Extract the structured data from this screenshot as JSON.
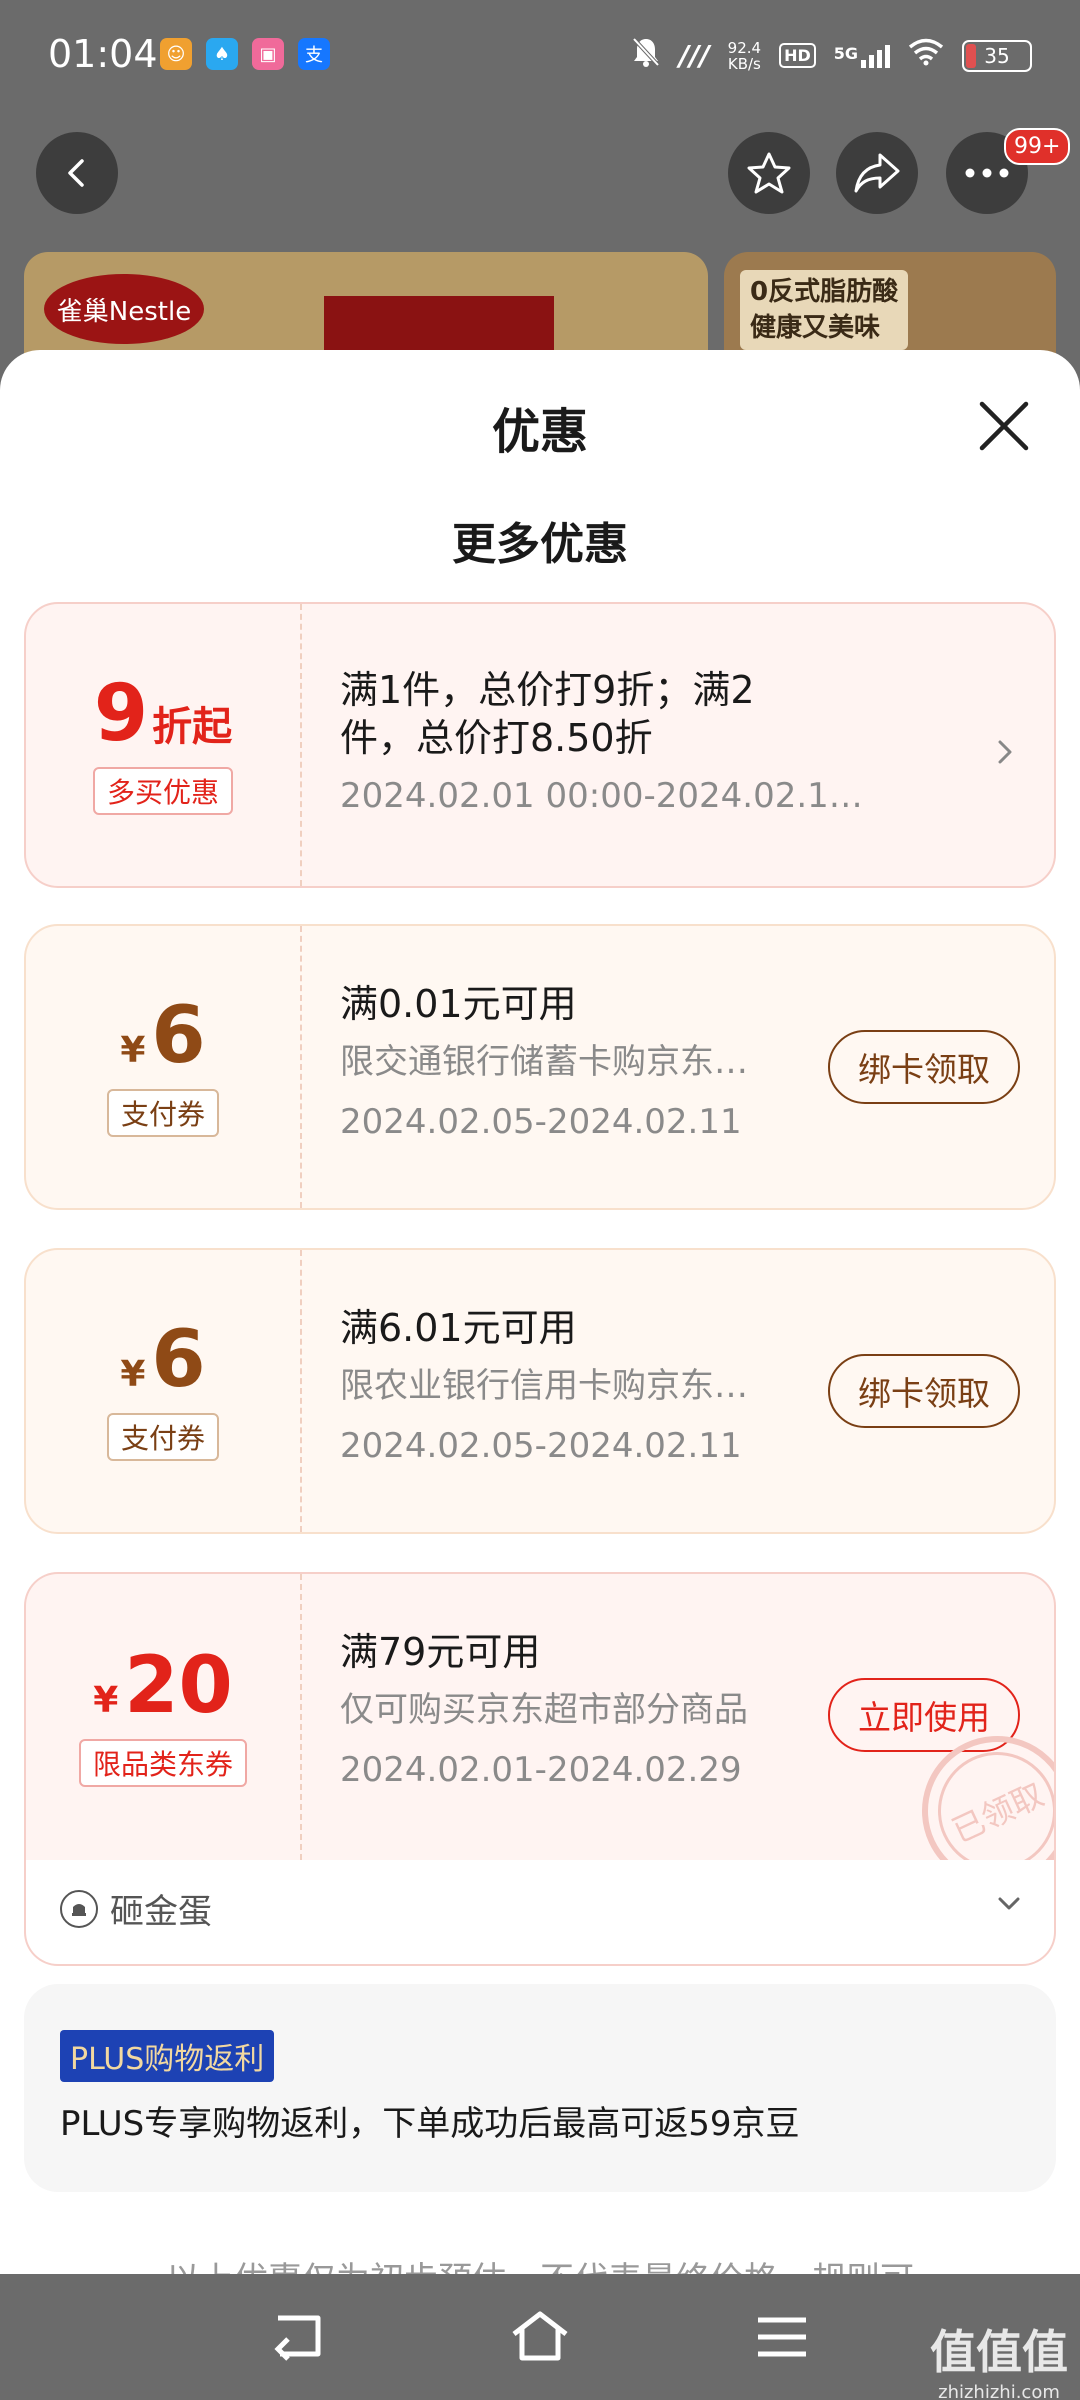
{
  "status_bar": {
    "time": "01:04",
    "net_speed_value": "92.4",
    "net_speed_unit": "KB/s",
    "hd": "HD",
    "signal": "5G",
    "battery": "35",
    "app_icons": [
      "doll-app-icon",
      "qq-icon",
      "bilibili-icon",
      "alipay-icon"
    ]
  },
  "top_nav": {
    "more_badge": "99+"
  },
  "background": {
    "product_logo": "雀巢Nestle",
    "promo_line1": "0反式脂肪酸",
    "promo_line2": "健康又美味"
  },
  "sheet": {
    "title": "优惠",
    "section_title": "更多优惠",
    "cards": [
      {
        "amount": "9",
        "unit": "折起",
        "tag": "多买优惠",
        "line1": "满1件，总价打9折；满2",
        "line2": "件，总价打8.50折",
        "line3": "2024.02.01 00:00-2024.02.1…"
      },
      {
        "currency": "¥",
        "amount": "6",
        "tag": "支付券",
        "line1": "满0.01元可用",
        "line2": "限交通银行储蓄卡购京东…",
        "line3": "2024.02.05-2024.02.11",
        "action": "绑卡领取"
      },
      {
        "currency": "¥",
        "amount": "6",
        "tag": "支付券",
        "line1": "满6.01元可用",
        "line2": "限农业银行信用卡购京东…",
        "line3": "2024.02.05-2024.02.11",
        "action": "绑卡领取"
      },
      {
        "currency": "¥",
        "amount": "20",
        "tag": "限品类东券",
        "line1": "满79元可用",
        "line2": "仅可购买京东超市部分商品",
        "line3": "2024.02.01-2024.02.29",
        "action": "立即使用",
        "stamp": "已领取"
      }
    ],
    "egg_label": "砸金蛋",
    "plus": {
      "tag": "PLUS购物返利",
      "text": "PLUS专享购物返利，下单成功后最高可返59京豆"
    },
    "footer_note": "以上优惠仅为初步预估，不代表最终价格，规则可"
  },
  "watermark": {
    "main": "值值值",
    "sub": "zhizhizhi.com"
  },
  "colors": {
    "price_red": "#e2231a",
    "coupon_brown": "#8f4a16",
    "plus_blue": "#1d42b4"
  }
}
